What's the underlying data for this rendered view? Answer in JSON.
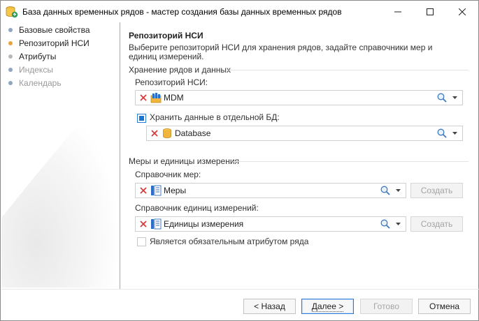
{
  "window": {
    "title": "База данных временных рядов - мастер создания базы данных временных рядов"
  },
  "nav": {
    "items": [
      {
        "label": "Базовые свойства",
        "state": "done",
        "color": "#8fa6c0"
      },
      {
        "label": "Репозиторий НСИ",
        "state": "active",
        "color": "#e8a33a"
      },
      {
        "label": "Атрибуты",
        "state": "done",
        "color": "#b8b8b8"
      },
      {
        "label": "Индексы",
        "state": "disabled",
        "color": "#8fa6c0"
      },
      {
        "label": "Календарь",
        "state": "disabled",
        "color": "#8fa6c0"
      }
    ]
  },
  "page": {
    "title": "Репозиторий НСИ",
    "description": "Выберите репозиторий НСИ для хранения рядов, задайте справочники мер и единиц измерений."
  },
  "storage": {
    "group_label": "Хранение рядов и данных",
    "repo_label": "Репозиторий НСИ:",
    "repo_value": "MDM",
    "repo_icon": "mdm-repository-icon",
    "separate_db_label": "Хранить данные в отдельной БД:",
    "separate_db_checked": true,
    "db_value": "Database",
    "db_icon": "database-icon"
  },
  "measures": {
    "group_label": "Меры и единицы измерения",
    "measures_label": "Справочник мер:",
    "measures_value": "Меры",
    "units_label": "Справочник единиц измерений:",
    "units_value": "Единицы измерения",
    "create_label": "Создать",
    "required_attr_label": "Является обязательным атрибутом ряда",
    "required_attr_checked": false
  },
  "footer": {
    "back_label": "< Назад",
    "next_label": "Далее >",
    "finish_label": "Готово",
    "cancel_label": "Отмена"
  },
  "colors": {
    "accent": "#1d73d1",
    "clear_x": "#d93434",
    "disabled_text": "#9a9a9a"
  }
}
